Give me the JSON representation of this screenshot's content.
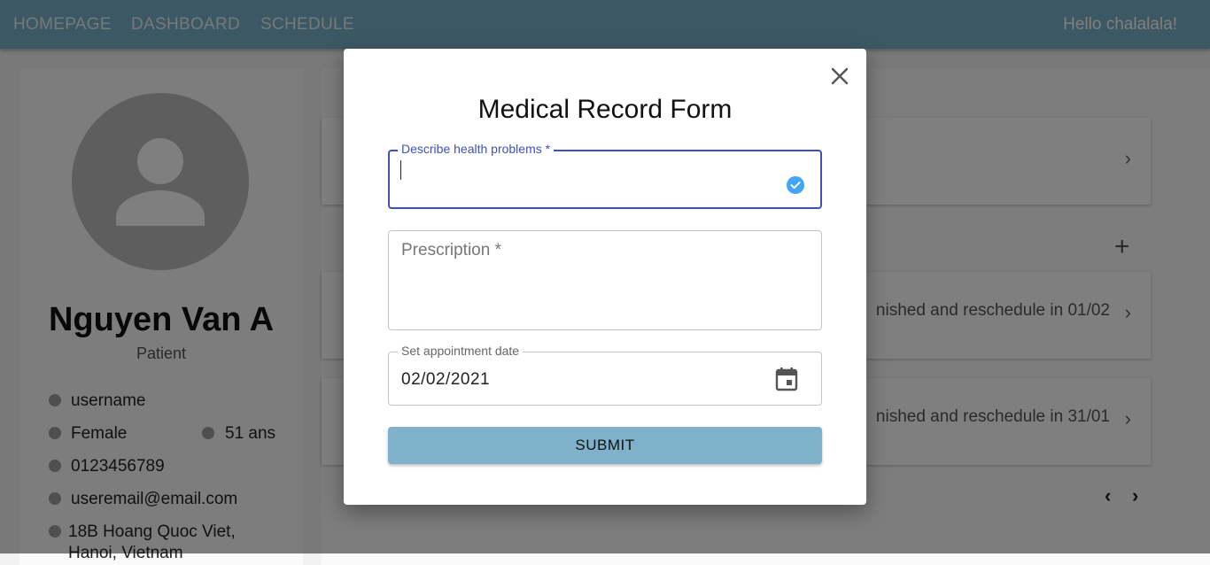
{
  "navbar": {
    "links": [
      "HOMEPAGE",
      "DASHBOARD",
      "SCHEDULE"
    ],
    "greeting": "Hello chalalala!"
  },
  "profile": {
    "avatar_icon": "person-icon",
    "name": "Nguyen Van A",
    "role": "Patient",
    "username": "username",
    "gender": "Female",
    "age": "51 ans",
    "phone": "0123456789",
    "email": "useremail@email.com",
    "address_line1": "18B Hoang Quoc Viet,",
    "address_line2": "Hanoi, Vietnam"
  },
  "records": {
    "item2_text": "nished and reschedule in 01/02",
    "item3_text": "nished and reschedule in 31/01"
  },
  "dialog": {
    "title": "Medical Record Form",
    "health_label": "Describe health problems *",
    "health_value": "",
    "prescription_label": "Prescription *",
    "date_label": "Set appointment date",
    "date_value": "02/02/2021",
    "submit_label": "SUBMIT"
  },
  "colors": {
    "navbar": "#7ab1cb",
    "focus": "#3f51b5",
    "check": "#42a5f5",
    "submit": "#7fb1ca"
  }
}
